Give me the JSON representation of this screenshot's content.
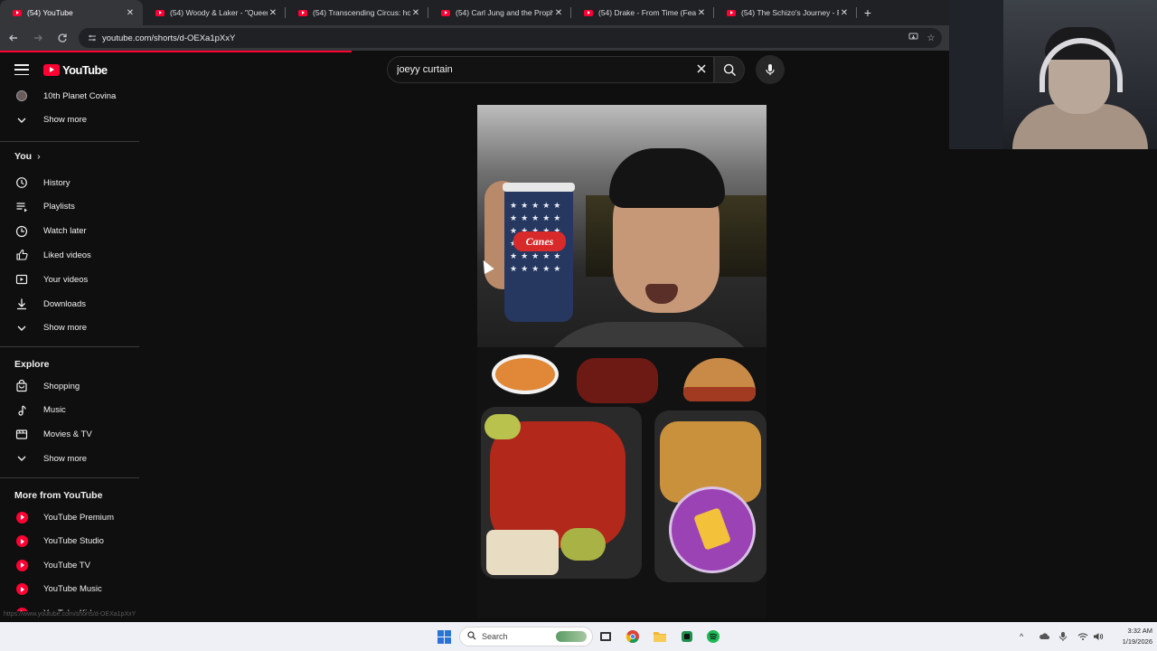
{
  "browser": {
    "tabs": [
      {
        "title": "(54) YouTube",
        "active": true
      },
      {
        "title": "(54) Woody & Laker - \"Queer E",
        "active": false
      },
      {
        "title": "(54) Transcending Circus: how t",
        "active": false
      },
      {
        "title": "(54) Carl Jung and the Prophec",
        "active": false
      },
      {
        "title": "(54) Drake - From Time (Feat. Je",
        "active": false
      },
      {
        "title": "(54) The Schizo's Journey - Fro",
        "active": false
      }
    ],
    "new_tab_label": "+",
    "close_label": "✕",
    "url": "youtube.com/shorts/d-OEXa1pXxY",
    "progress": 0.37,
    "accent": "#ff0033"
  },
  "youtube": {
    "logo_text": "YouTube",
    "search": {
      "value": "joeyy curtain",
      "placeholder": "Search"
    },
    "sidebar": {
      "top_items": [
        {
          "label": "10th Planet Covina",
          "icon": "channel-avatar"
        },
        {
          "label": "Show more",
          "icon": "chevron-down-icon"
        }
      ],
      "you_header": "You",
      "you_chevron": "›",
      "you_items": [
        {
          "label": "History",
          "icon": "history-icon"
        },
        {
          "label": "Playlists",
          "icon": "playlists-icon"
        },
        {
          "label": "Watch later",
          "icon": "clock-icon"
        },
        {
          "label": "Liked videos",
          "icon": "thumb-up-icon"
        },
        {
          "label": "Your videos",
          "icon": "video-icon"
        },
        {
          "label": "Downloads",
          "icon": "download-icon"
        },
        {
          "label": "Show more",
          "icon": "chevron-down-icon"
        }
      ],
      "explore_header": "Explore",
      "explore_items": [
        {
          "label": "Shopping",
          "icon": "shopping-bag-icon"
        },
        {
          "label": "Music",
          "icon": "music-note-icon"
        },
        {
          "label": "Movies & TV",
          "icon": "clapperboard-icon"
        },
        {
          "label": "Show more",
          "icon": "chevron-down-icon"
        }
      ],
      "more_header": "More from YouTube",
      "more_items": [
        {
          "label": "YouTube Premium",
          "icon": "youtube-premium-icon"
        },
        {
          "label": "YouTube Studio",
          "icon": "youtube-studio-icon"
        },
        {
          "label": "YouTube TV",
          "icon": "youtube-tv-icon"
        },
        {
          "label": "YouTube Music",
          "icon": "youtube-music-icon"
        },
        {
          "label": "YouTube Kids",
          "icon": "youtube-kids-icon"
        }
      ]
    },
    "status_url": "https://www.youtube.com/shorts/d-OEXa1pXxY",
    "short_cup_brand": "Canes"
  },
  "taskbar": {
    "search_label": "Search",
    "time": "3:32 AM",
    "date": "1/19/2026"
  }
}
